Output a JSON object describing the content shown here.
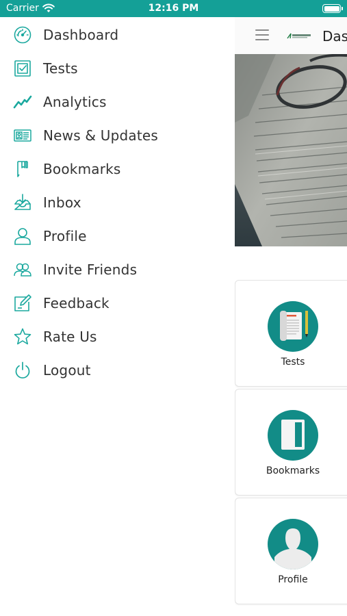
{
  "status_bar": {
    "carrier": "Carrier",
    "time": "12:16 PM"
  },
  "drawer": {
    "items": [
      {
        "label": "Dashboard",
        "icon": "speedometer-icon"
      },
      {
        "label": "Tests",
        "icon": "test-sheet-icon"
      },
      {
        "label": "Analytics",
        "icon": "trend-line-icon"
      },
      {
        "label": "News & Updates",
        "icon": "id-card-icon"
      },
      {
        "label": "Bookmarks",
        "icon": "bookmark-icon"
      },
      {
        "label": "Inbox",
        "icon": "inbox-icon"
      },
      {
        "label": "Profile",
        "icon": "user-icon"
      },
      {
        "label": "Invite Friends",
        "icon": "users-icon"
      },
      {
        "label": "Feedback",
        "icon": "edit-icon"
      },
      {
        "label": "Rate Us",
        "icon": "star-icon"
      },
      {
        "label": "Logout",
        "icon": "power-icon"
      }
    ]
  },
  "header": {
    "title": "Das"
  },
  "cards": [
    {
      "label": "Tests",
      "icon": "test-paper-icon"
    },
    {
      "label": "Bookmarks",
      "icon": "notebook-icon"
    },
    {
      "label": "Profile",
      "icon": "person-silhouette-icon"
    }
  ],
  "colors": {
    "accent": "#14a097",
    "icon_teal": "#1aa89e",
    "circle_bg": "#128c87",
    "text": "#333333"
  }
}
